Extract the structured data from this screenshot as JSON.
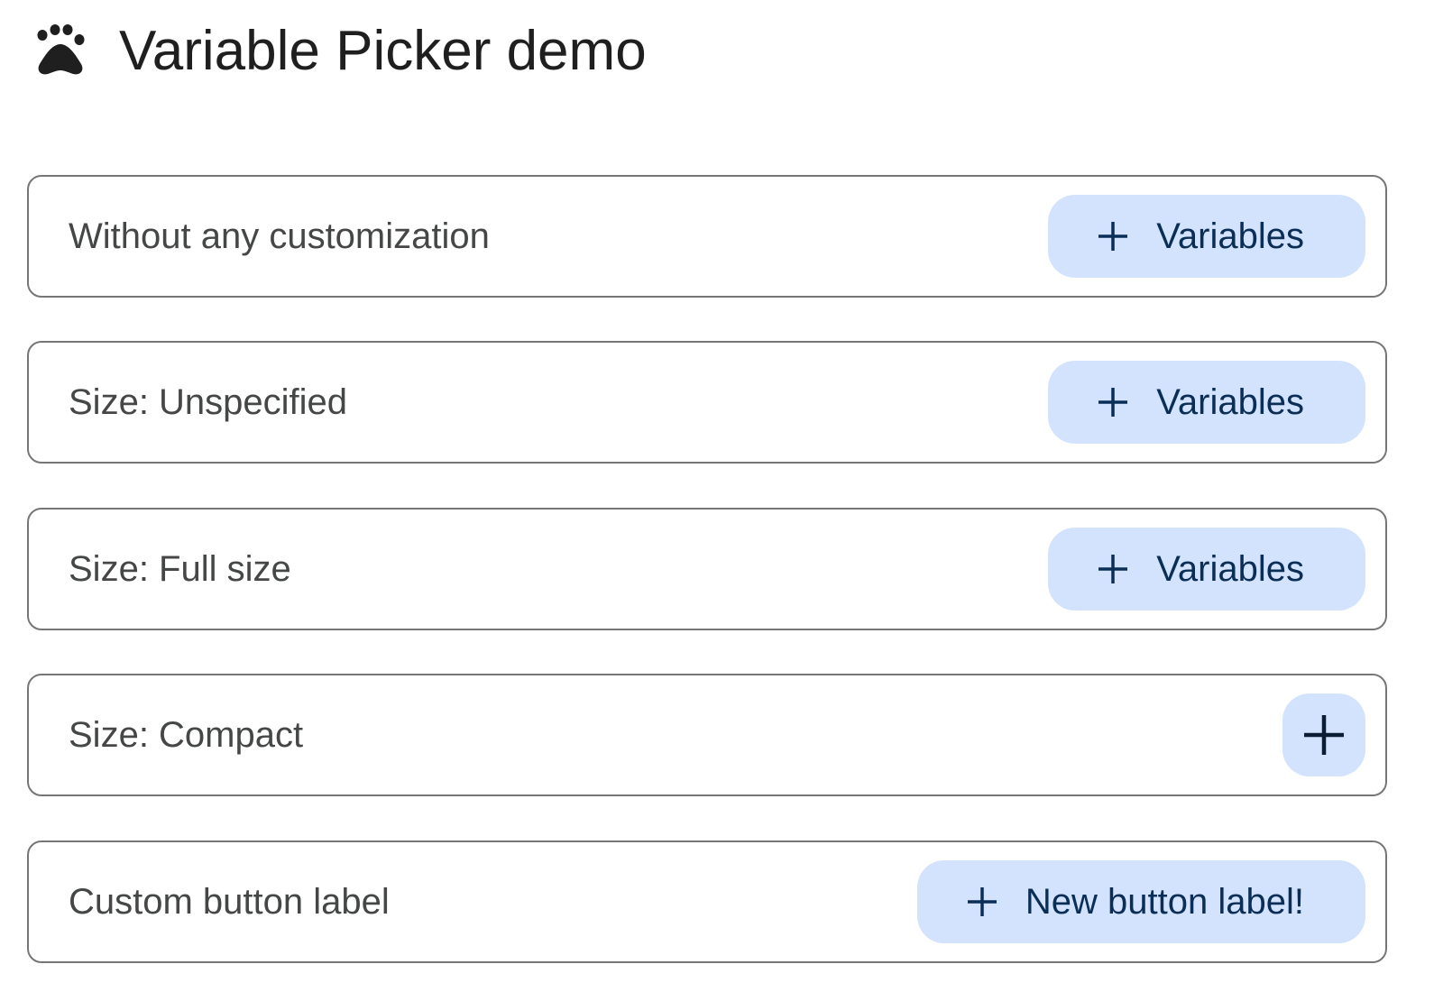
{
  "header": {
    "logo_icon": "paw-icon",
    "title": "Variable Picker demo"
  },
  "colors": {
    "button_bg": "#d3e3fd",
    "button_text": "#0b2e57",
    "card_border": "#747775"
  },
  "cards": [
    {
      "label": "Without any customization",
      "button": {
        "icon": "plus-icon",
        "label": "Variables",
        "size": "full"
      }
    },
    {
      "label": "Size: Unspecified",
      "button": {
        "icon": "plus-icon",
        "label": "Variables",
        "size": "full"
      }
    },
    {
      "label": "Size: Full size",
      "button": {
        "icon": "plus-icon",
        "label": "Variables",
        "size": "full"
      }
    },
    {
      "label": "Size: Compact",
      "button": {
        "icon": "plus-icon",
        "size": "compact"
      }
    },
    {
      "label": "Custom button label",
      "button": {
        "icon": "plus-icon",
        "label": "New button label!",
        "size": "full"
      }
    }
  ]
}
